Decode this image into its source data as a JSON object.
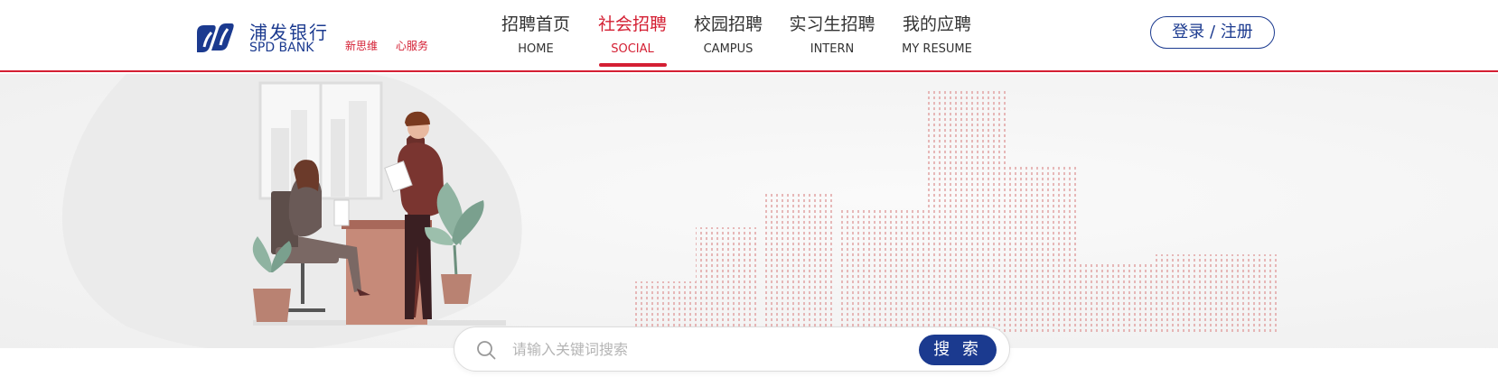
{
  "brand": {
    "name_cn": "浦发银行",
    "name_en": "SPD BANK",
    "slogans": [
      "新思维",
      "心服务"
    ],
    "primary_color": "#1b3a8f",
    "accent_color": "#d41f33"
  },
  "nav": {
    "items": [
      {
        "cn": "招聘首页",
        "en": "HOME",
        "active": false
      },
      {
        "cn": "社会招聘",
        "en": "SOCIAL",
        "active": true
      },
      {
        "cn": "校园招聘",
        "en": "CAMPUS",
        "active": false
      },
      {
        "cn": "实习生招聘",
        "en": "INTERN",
        "active": false
      },
      {
        "cn": "我的应聘",
        "en": "MY RESUME",
        "active": false
      }
    ]
  },
  "auth": {
    "login_label": "登录 / 注册"
  },
  "search": {
    "placeholder": "请输入关键词搜索",
    "button_label": "搜 索",
    "icon": "search-icon"
  }
}
